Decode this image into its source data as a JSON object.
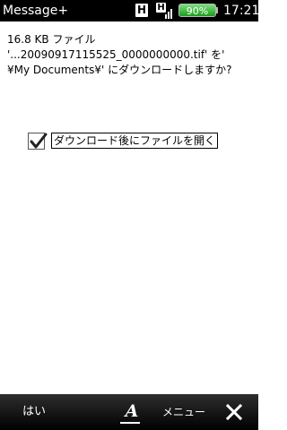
{
  "status_bar": {
    "app_title": "Message+",
    "network_badge_1": "H",
    "network_badge_2": "H",
    "battery_percent": "90%",
    "time": "17:21"
  },
  "dialog": {
    "message_lines": [
      "16.8 KB ファイル",
      "'...20090917115525_0000000000.tif' を'",
      "¥My Documents¥' にダウンロードしますか?"
    ],
    "checkbox": {
      "label": "ダウンロード後にファイルを開く",
      "checked": true
    }
  },
  "softkeys": {
    "left_label": "はい",
    "font_label": "A",
    "menu_label": "メニュー",
    "close_icon": "close-x-icon"
  },
  "colors": {
    "status_bar_bg": "#000000",
    "battery_green": "#2fb12f",
    "background": "#ffffff"
  }
}
